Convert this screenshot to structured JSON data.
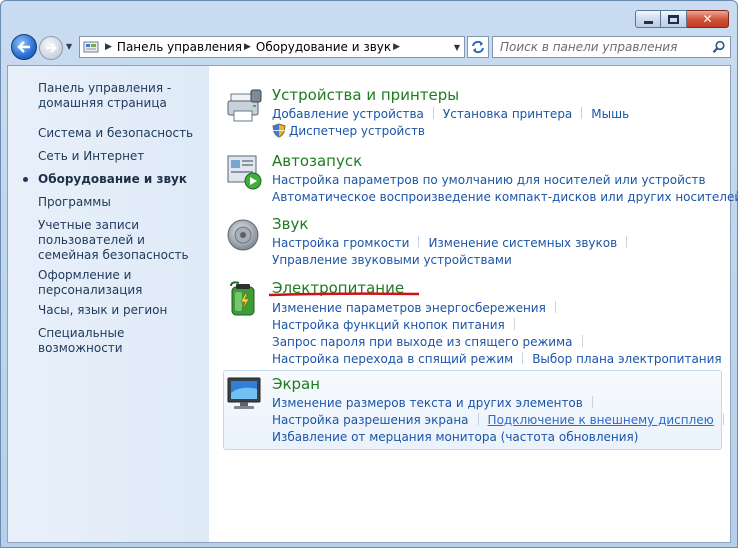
{
  "window": {
    "controls": {
      "minimize_icon": "minimize-icon",
      "maximize_icon": "maximize-icon",
      "close_icon": "close-icon"
    }
  },
  "nav": {
    "back_icon": "back-arrow-icon",
    "forward_icon": "forward-arrow-icon",
    "breadcrumbs": [
      "Панель управления",
      "Оборудование и звук"
    ],
    "search_placeholder": "Поиск в панели управления"
  },
  "sidebar": {
    "items": [
      {
        "label": "Панель управления - домашняя страница",
        "active": false
      },
      {
        "label": "Система и безопасность",
        "active": false
      },
      {
        "label": "Сеть и Интернет",
        "active": false
      },
      {
        "label": "Оборудование и звук",
        "active": true
      },
      {
        "label": "Программы",
        "active": false
      },
      {
        "label": "Учетные записи пользователей и семейная безопасность",
        "active": false
      },
      {
        "label": "Оформление и персонализация",
        "active": false
      },
      {
        "label": "Часы, язык и регион",
        "active": false
      },
      {
        "label": "Специальные возможности",
        "active": false
      }
    ]
  },
  "categories": [
    {
      "title": "Устройства и принтеры",
      "icon": "printer-icon",
      "lines": [
        [
          "Добавление устройства",
          "Установка принтера",
          "Мышь"
        ],
        [
          "Диспетчер устройств"
        ]
      ]
    },
    {
      "title": "Автозапуск",
      "icon": "autoplay-icon",
      "lines": [
        [
          "Настройка параметров по умолчанию для носителей или устройств"
        ],
        [
          "Автоматическое воспроизведение компакт-дисков или других носителей"
        ]
      ]
    },
    {
      "title": "Звук",
      "icon": "speaker-icon",
      "lines": [
        [
          "Настройка громкости",
          "Изменение системных звуков"
        ],
        [
          "Управление звуковыми устройствами"
        ]
      ]
    },
    {
      "title": "Электропитание",
      "icon": "battery-icon",
      "lines": [
        [
          "Изменение параметров энергосбережения"
        ],
        [
          "Настройка функций кнопок питания"
        ],
        [
          "Запрос пароля при выходе из спящего режима"
        ],
        [
          "Настройка перехода в спящий режим",
          "Выбор плана электропитания"
        ]
      ]
    },
    {
      "title": "Экран",
      "icon": "monitor-icon",
      "lines": [
        [
          "Изменение размеров текста и других элементов"
        ],
        [
          "Настройка разрешения экрана",
          "Подключение к внешнему дисплею"
        ],
        [
          "Избавление от мерцания монитора (частота обновления)"
        ]
      ]
    }
  ],
  "colors": {
    "category_title": "#1e7c1e",
    "link": "#1c55a8",
    "highlight_underline": "#d0121a"
  }
}
